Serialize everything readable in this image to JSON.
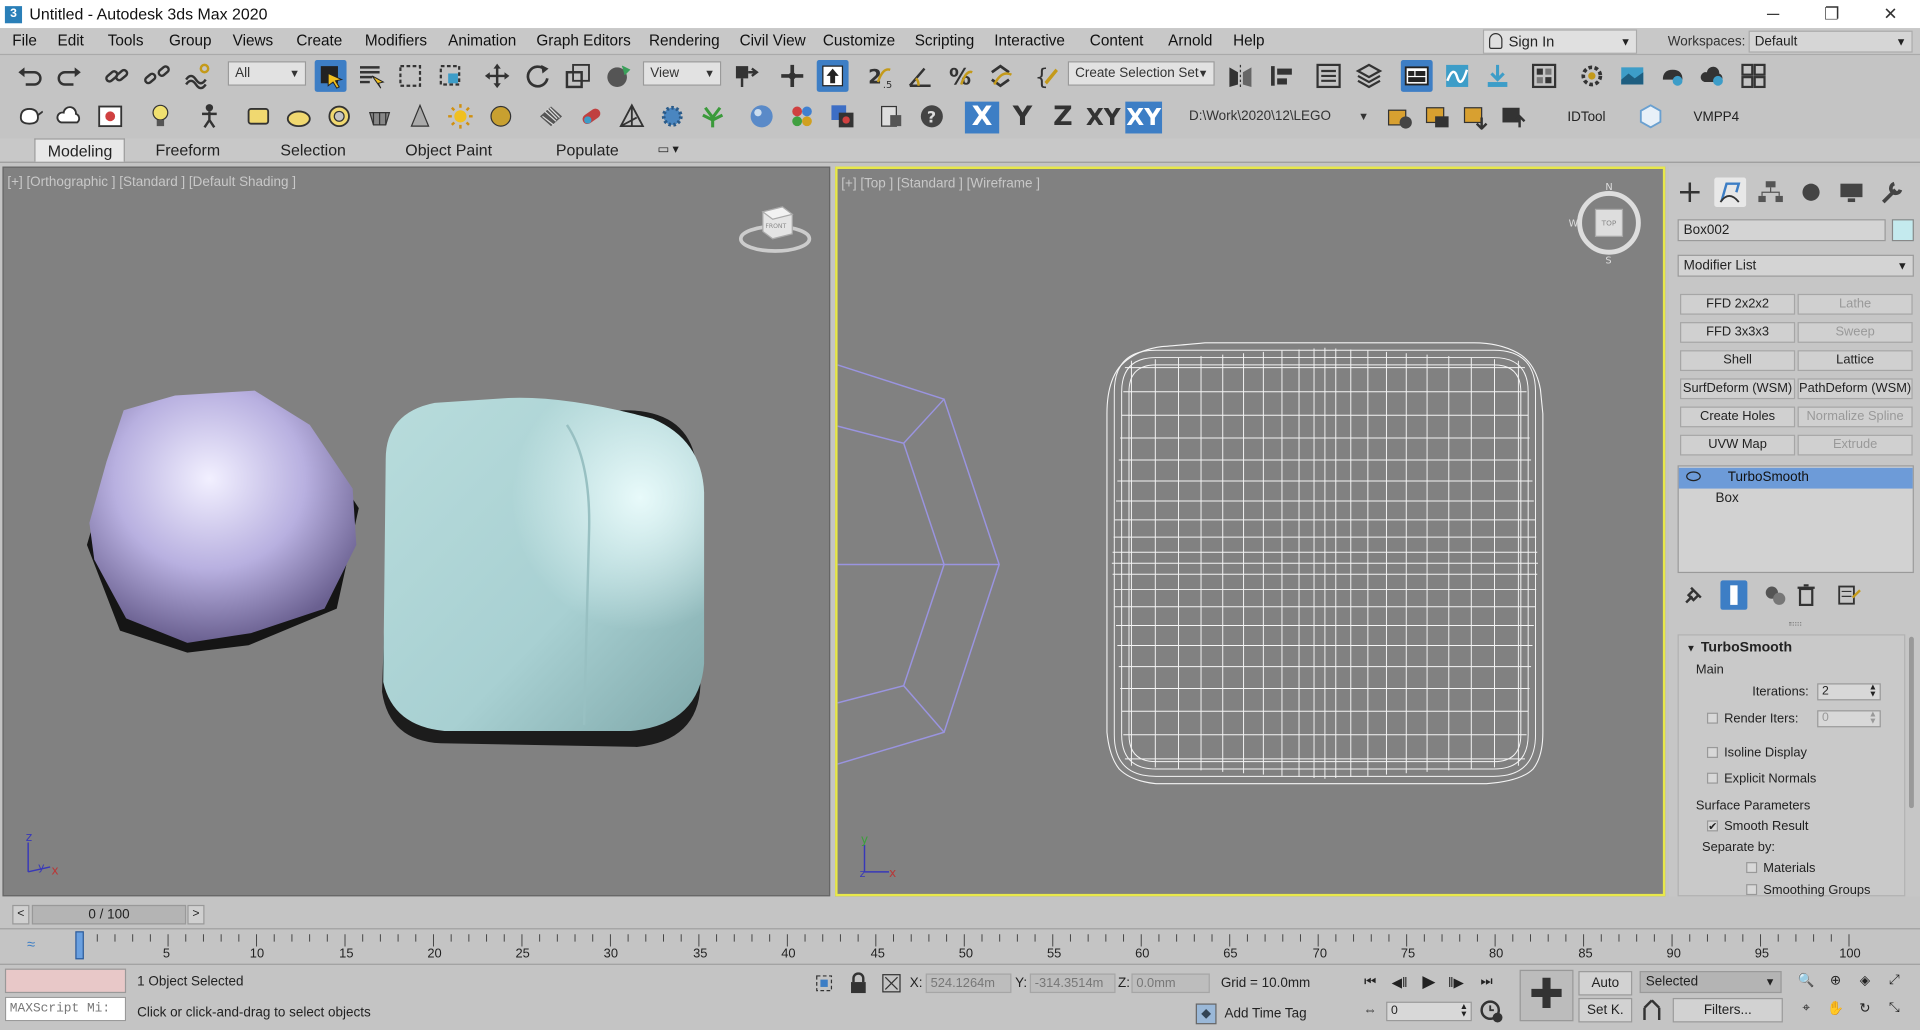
{
  "window": {
    "title": "Untitled - Autodesk 3ds Max 2020",
    "app_icon": "3",
    "minimize": "─",
    "maximize": "❐",
    "close": "✕"
  },
  "menu": {
    "items": [
      "File",
      "Edit",
      "Tools",
      "Group",
      "Views",
      "Create",
      "Modifiers",
      "Animation",
      "Graph Editors",
      "Rendering",
      "Civil View",
      "Customize",
      "Scripting",
      "Interactive",
      "Content",
      "Arnold",
      "Help"
    ],
    "sign_in": "Sign In",
    "workspaces_label": "Workspaces:",
    "workspace_value": "Default"
  },
  "toolbar": {
    "selection_filter": "All",
    "ref_coord": "View",
    "selection_set": "Create Selection Set",
    "axis_x": "X",
    "axis_y": "Y",
    "axis_z": "Z",
    "axis_xy": "XY",
    "axis_xy2": "XY",
    "project_path": "D:\\Work\\2020\\12\\LEGO",
    "idtool": "IDTool",
    "vmpp": "VMPP4"
  },
  "ribbon": {
    "tabs": [
      "Modeling",
      "Freeform",
      "Selection",
      "Object Paint",
      "Populate"
    ],
    "active": "Modeling"
  },
  "viewports": {
    "left_label": "[+] [Orthographic ] [Standard ] [Default Shading ]",
    "right_label": "[+] [Top ] [Standard ] [Wireframe ]",
    "viewcube_front": "FRONT",
    "viewcube_top": "TOP",
    "compass_n": "N",
    "compass_s": "S",
    "compass_w": "W",
    "axis_x": "x",
    "axis_y": "y",
    "axis_z": "z"
  },
  "command_panel": {
    "object_name": "Box002",
    "object_color": "#c4eaee",
    "modifier_list": "Modifier List",
    "modifier_buttons": [
      {
        "label": "FFD 2x2x2",
        "enabled": true
      },
      {
        "label": "Lathe",
        "enabled": false
      },
      {
        "label": "FFD 3x3x3",
        "enabled": true
      },
      {
        "label": "Sweep",
        "enabled": false
      },
      {
        "label": "Shell",
        "enabled": true
      },
      {
        "label": "Lattice",
        "enabled": true
      },
      {
        "label": "SurfDeform (WSM)",
        "enabled": true
      },
      {
        "label": "PathDeform (WSM)",
        "enabled": true
      },
      {
        "label": "Create Holes",
        "enabled": true
      },
      {
        "label": "Normalize Spline",
        "enabled": false
      },
      {
        "label": "UVW Map",
        "enabled": true
      },
      {
        "label": "Extrude",
        "enabled": false
      }
    ],
    "stack": {
      "selected": "TurboSmooth",
      "base": "Box"
    },
    "rollout": {
      "title": "TurboSmooth",
      "main": "Main",
      "iterations_label": "Iterations:",
      "iterations_value": "2",
      "render_iters_label": "Render Iters:",
      "render_iters_value": "0",
      "isoline": "Isoline Display",
      "explicit_normals": "Explicit Normals",
      "surface_params": "Surface Parameters",
      "smooth_result": "Smooth Result",
      "smooth_result_checked": "✔",
      "separate_by": "Separate by:",
      "materials": "Materials",
      "smoothing_groups": "Smoothing Groups"
    }
  },
  "timeline": {
    "frame_display": "0 / 100",
    "prev": "<",
    "next": ">",
    "ticks": [
      "5",
      "10",
      "15",
      "20",
      "25",
      "30",
      "35",
      "40",
      "45",
      "50",
      "55",
      "60",
      "65",
      "70",
      "75",
      "80",
      "85",
      "90",
      "95",
      "100"
    ]
  },
  "status": {
    "maxscript_placeholder": "MAXScript Mi:",
    "selection": "1 Object Selected",
    "prompt": "Click or click-and-drag to select objects",
    "x_label": "X:",
    "x_value": "524.1264m",
    "y_label": "Y:",
    "y_value": "-314.3514m",
    "z_label": "Z:",
    "z_value": "0.0mm",
    "grid": "Grid = 10.0mm",
    "add_time_tag": "Add Time Tag",
    "auto_key": "Auto",
    "set_key": "Set K.",
    "key_filter": "Selected",
    "filters": "Filters...",
    "current_frame": "0"
  }
}
